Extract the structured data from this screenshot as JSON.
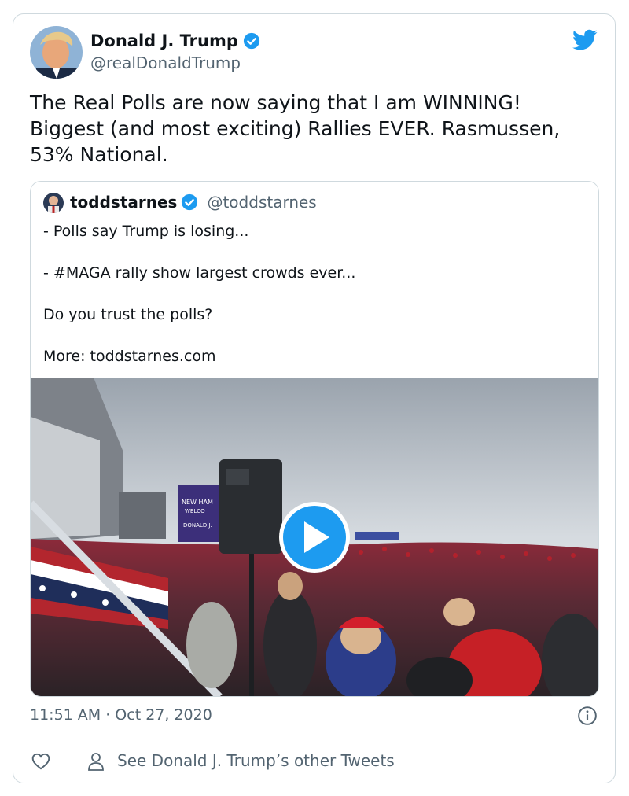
{
  "tweet": {
    "author_name": "Donald J. Trump",
    "author_handle": "@realDonaldTrump",
    "text": "The Real Polls are now saying that I am WINNING!\nBiggest (and most exciting) Rallies EVER. Rasmussen,\n53% National.",
    "timestamp": "11:51 AM · Oct 27, 2020",
    "other_tweets_link": "See Donald J. Trump’s other Tweets"
  },
  "quoted_tweet": {
    "author_name": "toddstarnes",
    "author_handle": "@toddstarnes",
    "text": "- Polls say Trump is losing...\n\n- #MAGA rally show largest crowds ever...\n\nDo you trust the polls?\n\nMore: toddstarnes.com",
    "media": {
      "type": "video",
      "banner_text": "NEW HAMPSHIRE WELCOMES PRESIDENT DONALD J."
    }
  },
  "icons": {
    "verified": "verified-badge-icon",
    "twitter": "twitter-bird-icon",
    "play": "play-icon",
    "info": "info-icon",
    "like": "heart-icon",
    "profile": "person-icon"
  },
  "colors": {
    "brand": "#1d9bf0",
    "text": "#0f1419",
    "secondary": "#536471",
    "border": "#cfd9de"
  }
}
